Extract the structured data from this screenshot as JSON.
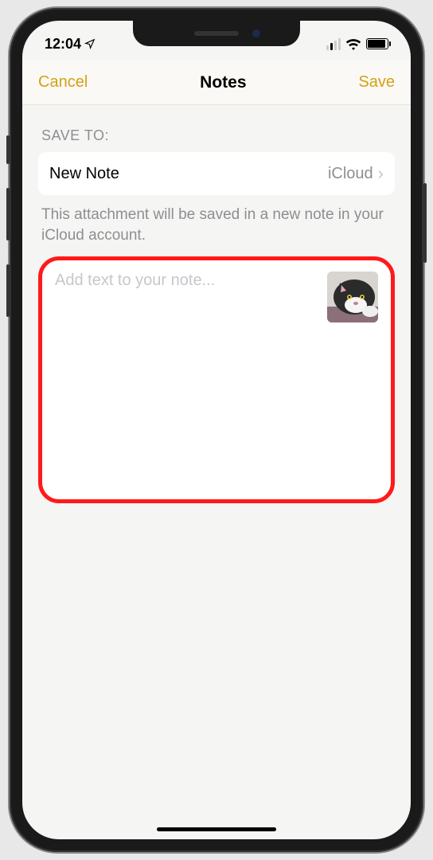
{
  "status": {
    "time": "12:04"
  },
  "nav": {
    "cancel": "Cancel",
    "title": "Notes",
    "save": "Save"
  },
  "section": {
    "label": "SAVE TO:",
    "destination": {
      "title": "New Note",
      "account": "iCloud"
    },
    "description": "This attachment will be saved in a new note in your iCloud account."
  },
  "compose": {
    "placeholder": "Add text to your note..."
  },
  "colors": {
    "accent": "#d4a017",
    "highlight": "#ff1a1a"
  }
}
